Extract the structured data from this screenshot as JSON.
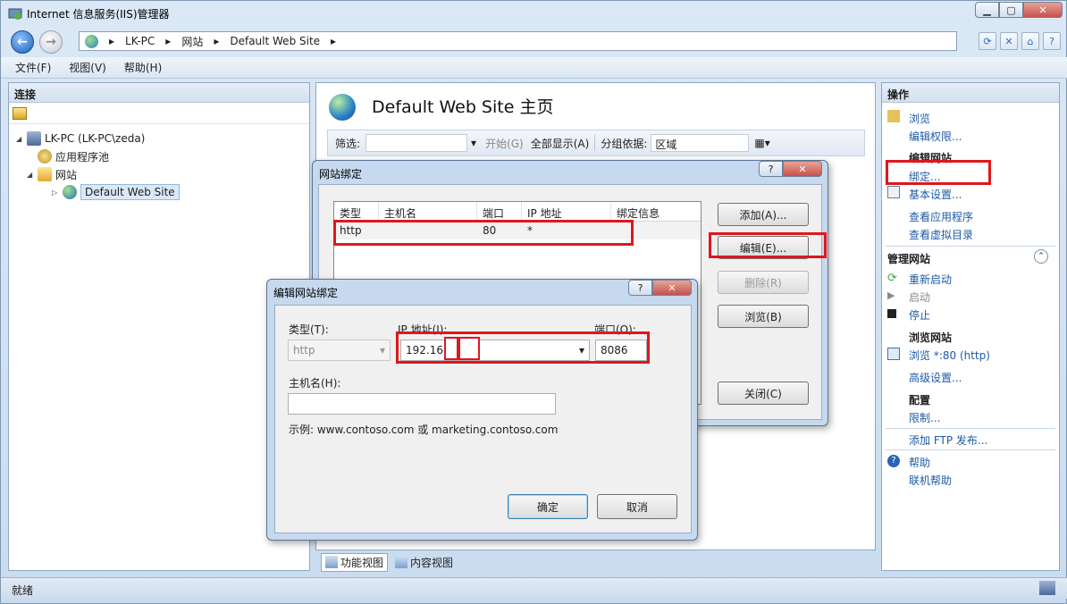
{
  "window": {
    "title": "Internet 信息服务(IIS)管理器"
  },
  "address": {
    "segments": [
      "LK-PC",
      "网站",
      "Default Web Site"
    ]
  },
  "menu": [
    "文件(F)",
    "视图(V)",
    "帮助(H)"
  ],
  "connections": {
    "title": "连接",
    "tree": {
      "server": "LK-PC (LK-PC\\zeda)",
      "app_pools": "应用程序池",
      "sites": "网站",
      "site": "Default Web Site"
    }
  },
  "center": {
    "title": "Default Web Site 主页",
    "filter_label": "筛选:",
    "go": "开始(G)",
    "show_all": "全部显示(A)",
    "group_by": "分组依据:",
    "group_value": "区域",
    "tabs": [
      "功能视图",
      "内容视图"
    ]
  },
  "actions": {
    "title": "操作",
    "browse": "浏览",
    "edit_perms": "编辑权限...",
    "edit_site": "编辑网站",
    "bindings": "绑定...",
    "basic_settings": "基本设置...",
    "view_apps": "查看应用程序",
    "view_vdirs": "查看虚拟目录",
    "manage_site": "管理网站",
    "restart": "重新启动",
    "start": "启动",
    "stop": "停止",
    "browse_site": "浏览网站",
    "browse_http": "浏览 *:80 (http)",
    "advanced": "高级设置...",
    "config": "配置",
    "limits": "限制...",
    "ftp": "添加 FTP 发布...",
    "help": "帮助",
    "online_help": "联机帮助"
  },
  "status": "就绪",
  "bindings_dialog": {
    "title": "网站绑定",
    "columns": [
      "类型",
      "主机名",
      "端口",
      "IP 地址",
      "绑定信息"
    ],
    "rows": [
      {
        "type": "http",
        "host": "",
        "port": "80",
        "ip": "*",
        "info": ""
      }
    ],
    "add": "添加(A)...",
    "edit": "编辑(E)...",
    "remove": "删除(R)",
    "browse": "浏览(B)",
    "close": "关闭(C)"
  },
  "edit_dialog": {
    "title": "编辑网站绑定",
    "type_label": "类型(T):",
    "type_value": "http",
    "ip_label": "IP 地址(I):",
    "ip_value": "192.168.",
    "port_label": "端口(O):",
    "port_value": "8086",
    "host_label": "主机名(H):",
    "host_value": "",
    "example": "示例: www.contoso.com 或 marketing.contoso.com",
    "ok": "确定",
    "cancel": "取消"
  }
}
